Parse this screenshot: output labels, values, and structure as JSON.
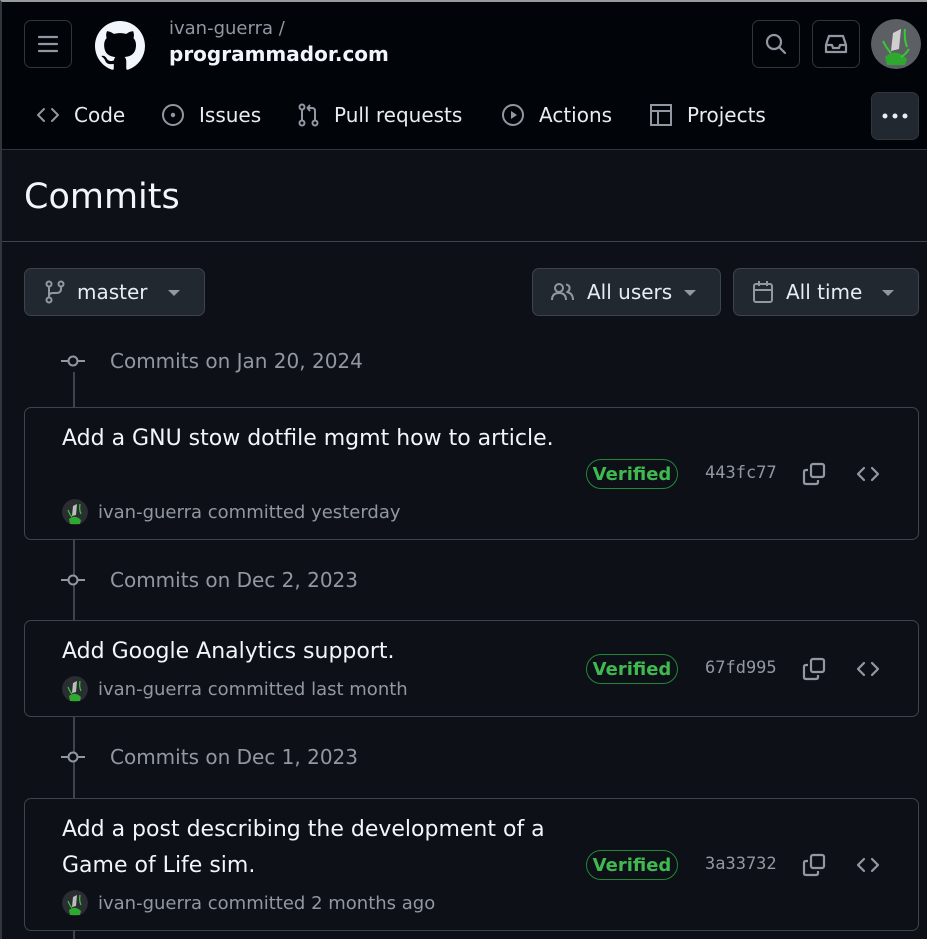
{
  "header": {
    "repo_owner": "ivan-guerra /",
    "repo_name": "programmador.com",
    "nav": [
      {
        "label": "Code",
        "icon": "code-icon"
      },
      {
        "label": "Issues",
        "icon": "issue-opened-icon"
      },
      {
        "label": "Pull requests",
        "icon": "git-pull-request-icon"
      },
      {
        "label": "Actions",
        "icon": "play-icon"
      },
      {
        "label": "Projects",
        "icon": "table-icon"
      }
    ]
  },
  "page": {
    "title": "Commits"
  },
  "filters": {
    "branch": "master",
    "users": "All users",
    "time": "All time"
  },
  "groups": [
    {
      "date": "Commits on Jan 20, 2024",
      "commits": [
        {
          "message": "Add a GNU stow dotfile mgmt how to article.",
          "author": "ivan-guerra",
          "action": "committed",
          "when": "yesterday",
          "badge": "Verified",
          "sha": "443fc77"
        }
      ]
    },
    {
      "date": "Commits on Dec 2, 2023",
      "commits": [
        {
          "message": "Add Google Analytics support.",
          "author": "ivan-guerra",
          "action": "committed",
          "when": "last month",
          "badge": "Verified",
          "sha": "67fd995"
        }
      ]
    },
    {
      "date": "Commits on Dec 1, 2023",
      "commits": [
        {
          "message": "Add a post describing the development of a Game of Life sim.",
          "author": "ivan-guerra",
          "action": "committed",
          "when": "2 months ago",
          "badge": "Verified",
          "sha": "3a33732"
        }
      ]
    }
  ],
  "colors": {
    "header_bg": "#010409",
    "page_bg": "#0d1117",
    "verified_green": "#3fb950",
    "border": "#3d444d"
  }
}
